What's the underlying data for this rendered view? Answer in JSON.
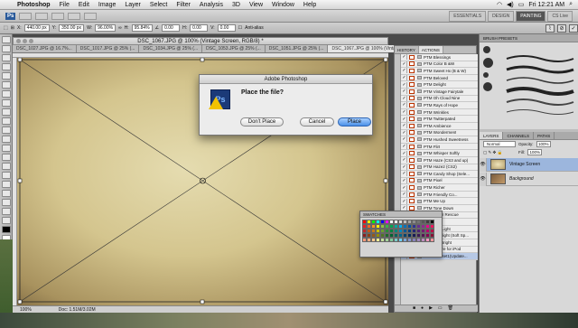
{
  "menubar": {
    "apple": "",
    "app_name": "Photoshop",
    "items": [
      "File",
      "Edit",
      "Image",
      "Layer",
      "Select",
      "Filter",
      "Analysis",
      "3D",
      "View",
      "Window",
      "Help"
    ],
    "clock": "Fri 12:21 AM"
  },
  "appbar": {
    "ps_label": "Ps",
    "workspaces": [
      "ESSENTIALS",
      "DESIGN",
      "PAINTING"
    ],
    "active_workspace": "PAINTING",
    "cslive": "CS Live"
  },
  "options": {
    "x": "440.00 px",
    "y": "350.00 px",
    "w": "96.00%",
    "h": "95.84%",
    "angle": "0.00",
    "hskew": "0.00",
    "vskew": "0.00",
    "antialias": "Anti-alias"
  },
  "document": {
    "window_title": "DSC_1067.JPG @ 100% (Vintage Screen, RGB/8) *",
    "tabs": [
      "DSC_1027.JPG @ 16.7%...",
      "DSC_1017.JPG @ 25% (...",
      "DSC_1034.JPG @ 25% (...",
      "DSC_1053.JPG @ 25% (...",
      "DSC_1051.JPG @ 25% (...",
      "DSC_1067.JPG @ 100% (Vintage Screen, RGB/8) *"
    ],
    "status_zoom": "100%",
    "status_doc": "Doc: 1.51M/3.02M"
  },
  "dialog": {
    "title": "Adobe Photoshop",
    "icon_label": "Ps",
    "message": "Place the file?",
    "buttons": {
      "dont_place": "Don't Place",
      "cancel": "Cancel",
      "place": "Place"
    }
  },
  "actions_panel": {
    "tabs": [
      "HISTORY",
      "ACTIONS"
    ],
    "active_tab": "ACTIONS",
    "items": [
      "PTM Blessings",
      "PTM Color B &W",
      "PTM Sweet Hx (B & W)",
      "PTM Beloved",
      "PTM Delight",
      "PTM Vintage Fairytale",
      "PTM Oh Cloud Nine",
      "PTM Rays of Hope",
      "PTM Wrinkles",
      "PTM Twitterpated",
      "PTM Ambience",
      "PTM Wonderment",
      "PTM Hushed Sweetness",
      "PTM Flirt",
      "PTM Whisper Softly",
      "PTM Haze (CS3 and up)",
      "PTM Haze2 (CS2)",
      "PTM Candy Shop (Sele...",
      "PTM Pixel",
      "PTM Richer",
      "PTM Friendly Co...",
      "PTM Me Up",
      "PTM Tone Down",
      "PTM Tuder Rescue",
      "PTM Zest",
      "PTM Soft Light",
      "PTM Limelight (Soft Sp...",
      "PTM Too Bright",
      "PTM Resize for iPod",
      "PWActionSet1(Update..."
    ],
    "selected_index": 29
  },
  "swatches": {
    "title": "SWATCHES",
    "colors": [
      "#ff0000",
      "#ffff00",
      "#00ff00",
      "#00ffff",
      "#0000ff",
      "#ff00ff",
      "#ffffff",
      "#f2f2f2",
      "#d9d9d9",
      "#bfbfbf",
      "#a6a6a6",
      "#8c8c8c",
      "#737373",
      "#595959",
      "#404040",
      "#000000",
      "#ed1c24",
      "#f26522",
      "#f7941d",
      "#fff200",
      "#8dc63f",
      "#39b54a",
      "#00a651",
      "#00a99d",
      "#00aeef",
      "#0072bc",
      "#0054a6",
      "#2e3192",
      "#662d91",
      "#92278f",
      "#ec008c",
      "#ed145b",
      "#c1272d",
      "#c2571a",
      "#c97b1a",
      "#c7c000",
      "#6e9e30",
      "#2a8d38",
      "#00833f",
      "#00847a",
      "#0088bb",
      "#005a96",
      "#003f80",
      "#222574",
      "#4f2272",
      "#731d70",
      "#b5006b",
      "#b80f45",
      "#8c1d1f",
      "#8f3f13",
      "#94591a",
      "#948f00",
      "#517524",
      "#1d6a28",
      "#00622f",
      "#00625b",
      "#00668c",
      "#00436f",
      "#002e60",
      "#181b55",
      "#3a1955",
      "#551453",
      "#850050",
      "#881034",
      "#f69679",
      "#f9ad81",
      "#fdc68a",
      "#fff799",
      "#c4df9b",
      "#a3d39c",
      "#82ca9c",
      "#7accc8",
      "#6dcff6",
      "#7da7d9",
      "#8393ca",
      "#8781bd",
      "#a187be",
      "#bd8cbf",
      "#f49ac1",
      "#f5989d"
    ]
  },
  "right_dock": {
    "brush_title": "BRUSH PRESETS",
    "layers_tabs": [
      "LAYERS",
      "CHANNELS",
      "PATHS"
    ],
    "blend_mode": "Normal",
    "opacity_label": "Opacity:",
    "opacity": "100%",
    "fill_label": "Fill:",
    "fill": "100%",
    "layers": [
      {
        "name": "Vintage Screen",
        "selected": true
      },
      {
        "name": "Background",
        "selected": false
      }
    ]
  }
}
